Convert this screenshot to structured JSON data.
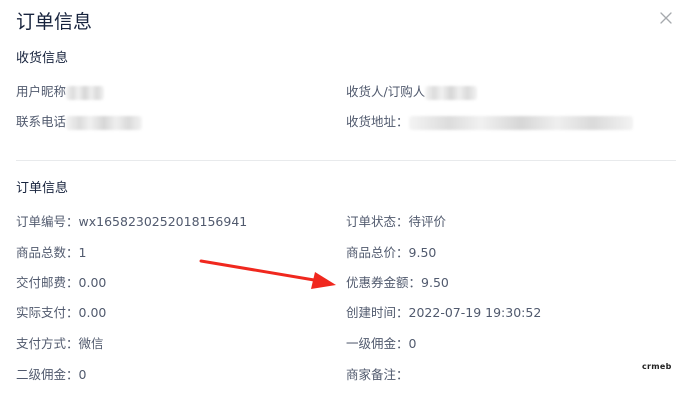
{
  "dialog": {
    "title": "订单信息",
    "close_icon": "close-icon"
  },
  "shipping": {
    "section_title": "收货信息",
    "nickname_label": "用户昵称",
    "phone_label": "联系电话",
    "receiver_label": "收货人/订购人",
    "address_label": "收货地址："
  },
  "order": {
    "section_title": "订单信息",
    "order_no_label": "订单编号：",
    "order_no_value": "wx1658230252018156941",
    "order_status_label": "订单状态：",
    "order_status_value": "待评价",
    "total_items_label": "商品总数：",
    "total_items_value": "1",
    "total_price_label": "商品总价：",
    "total_price_value": "9.50",
    "shipping_fee_label": "交付邮费：",
    "shipping_fee_value": "0.00",
    "coupon_label": "优惠券金额：",
    "coupon_value": "9.50",
    "paid_label": "实际支付：",
    "paid_value": "0.00",
    "created_label": "创建时间：",
    "created_value": "2022-07-19 19:30:52",
    "pay_method_label": "支付方式：",
    "pay_method_value": "微信",
    "level1_commission_label": "一级佣金：",
    "level1_commission_value": "0",
    "level2_commission_label": "二级佣金：",
    "level2_commission_value": "0",
    "merchant_note_label": "商家备注：",
    "merchant_note_value": ""
  },
  "annotation": {
    "arrow_color": "#f0281e"
  },
  "watermark": "crmeb"
}
